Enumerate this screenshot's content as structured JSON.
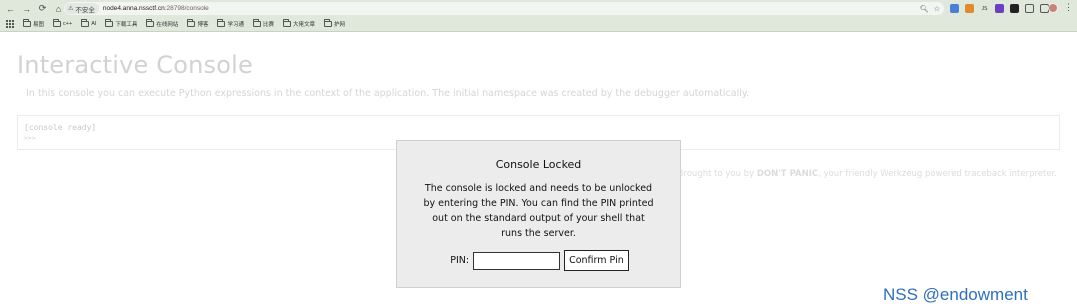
{
  "browser": {
    "nav": {
      "back_icon": "←",
      "forward_icon": "→",
      "reload_icon": "⟳",
      "home_icon": "⌂"
    },
    "address": {
      "security_label": "不安全",
      "host": "node4.anna.nssctf.cn",
      "path": ":28798/console"
    },
    "bookmarks": [
      "易图",
      "c++",
      "AI",
      "下载工具",
      "在线网站",
      "博客",
      "学习通",
      "比赛",
      "大佬文章",
      "护网"
    ],
    "colors": {
      "chrome": "#dfe8db"
    }
  },
  "page": {
    "title": "Interactive Console",
    "intro": "In this console you can execute Python expressions in the context of the application. The initial namespace was created by the debugger automatically.",
    "console_ready": "[console ready]",
    "console_prompt": ">>>",
    "footer_prefix": "Brought to you by ",
    "footer_bold": "DON'T PANIC",
    "footer_suffix": ", your friendly Werkzeug powered traceback interpreter."
  },
  "modal": {
    "title": "Console Locked",
    "message": "The console is locked and needs to be unlocked by entering the PIN. You can find the PIN printed out on the standard output of your shell that runs the server.",
    "pin_label": "PIN:",
    "pin_value": "",
    "confirm_label": "Confirm Pin"
  },
  "watermark": "NSS @endowment"
}
